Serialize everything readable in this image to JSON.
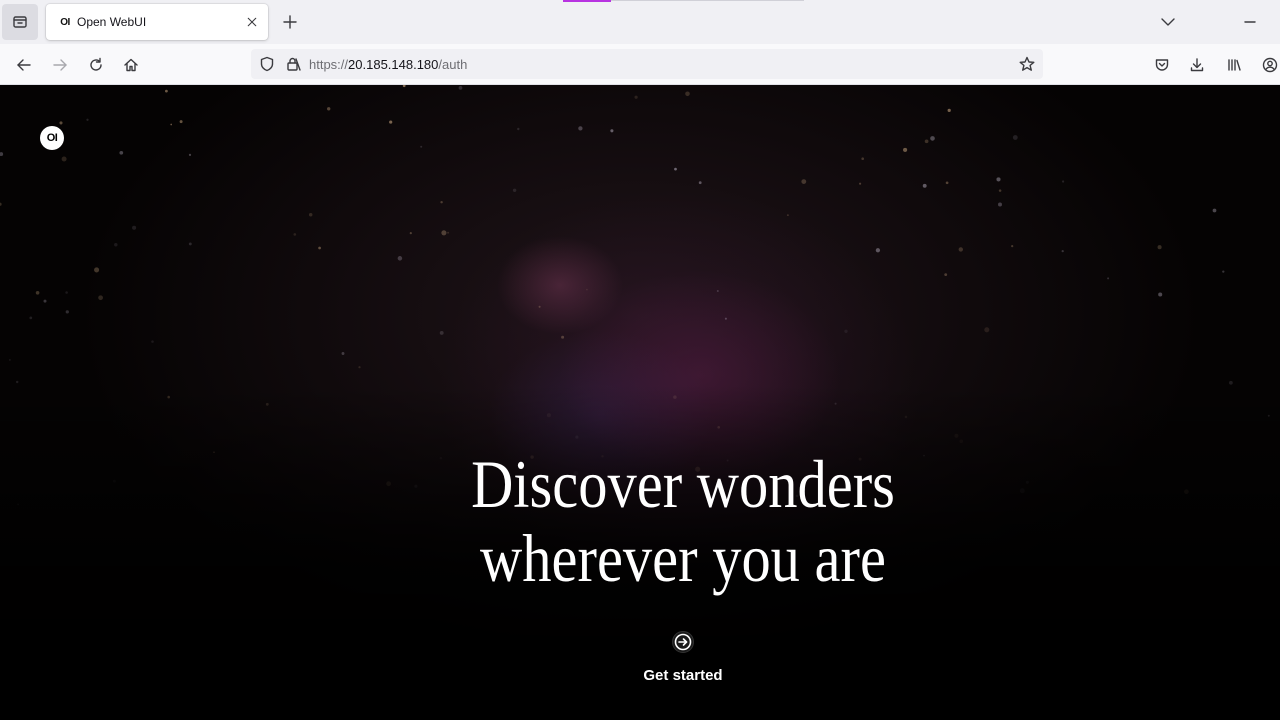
{
  "browser": {
    "tab": {
      "favicon_text": "OI",
      "title": "Open WebUI"
    },
    "url": {
      "scheme": "https://",
      "host": "20.185.148.180",
      "path": "/auth"
    }
  },
  "page": {
    "logo_text": "OI",
    "headline_line1": "Discover wonders",
    "headline_line2": "wherever you are",
    "cta_label": "Get started"
  },
  "icons": {
    "tab_list": "tab-list-icon",
    "close": "close-icon",
    "new_tab": "plus-icon",
    "overflow": "chevron-down-icon",
    "minimize": "minimize-icon",
    "back": "arrow-left-icon",
    "forward": "arrow-right-icon",
    "reload": "reload-icon",
    "home": "home-icon",
    "shield": "shield-icon",
    "lock": "lock-icon",
    "bookmark": "star-icon",
    "pocket": "pocket-icon",
    "downloads": "download-icon",
    "library": "library-icon",
    "account": "account-icon",
    "cta": "arrow-circle-right-icon"
  },
  "colors": {
    "accent": "#b833e1",
    "page_background": "#000000",
    "text_primary": "#ffffff"
  }
}
